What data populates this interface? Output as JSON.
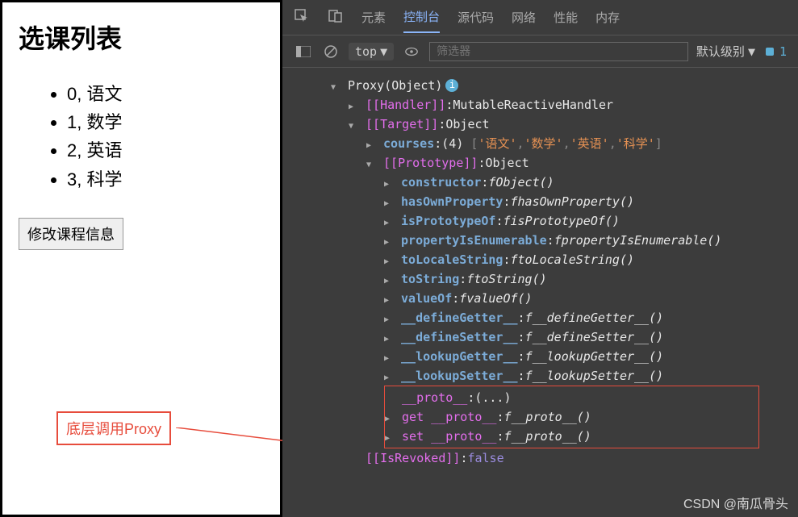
{
  "page": {
    "title": "选课列表",
    "courses": [
      "0, 语文",
      "1, 数学",
      "2, 英语",
      "3, 科学"
    ],
    "button": "修改课程信息"
  },
  "annotation": "底层调用Proxy",
  "devtools": {
    "tabs": {
      "elements": "元素",
      "console": "控制台",
      "sources": "源代码",
      "network": "网络",
      "performance": "性能",
      "memory": "内存"
    },
    "toolbar": {
      "scope": "top",
      "filter_placeholder": "筛选器",
      "level": "默认级别",
      "issue_count": "1"
    },
    "console": {
      "proxy_header": "Proxy(Object)",
      "handler_key": "[[Handler]]",
      "handler_val": "MutableReactiveHandler",
      "target_key": "[[Target]]",
      "target_val": "Object",
      "courses_key": "courses",
      "courses_len": "(4)",
      "courses_arr_open": "[",
      "courses_arr_close": "]",
      "courses_items": [
        "'语文'",
        "'数学'",
        "'英语'",
        "'科学'"
      ],
      "proto_key": "[[Prototype]]",
      "proto_val": "Object",
      "methods": [
        {
          "name": "constructor",
          "fn": "Object()"
        },
        {
          "name": "hasOwnProperty",
          "fn": "hasOwnProperty()"
        },
        {
          "name": "isPrototypeOf",
          "fn": "isPrototypeOf()"
        },
        {
          "name": "propertyIsEnumerable",
          "fn": "propertyIsEnumerable()"
        },
        {
          "name": "toLocaleString",
          "fn": "toLocaleString()"
        },
        {
          "name": "toString",
          "fn": "toString()"
        },
        {
          "name": "valueOf",
          "fn": "valueOf()"
        },
        {
          "name": "__defineGetter__",
          "fn": "__defineGetter__()"
        },
        {
          "name": "__defineSetter__",
          "fn": "__defineSetter__()"
        },
        {
          "name": "__lookupGetter__",
          "fn": "__lookupGetter__()"
        },
        {
          "name": "__lookupSetter__",
          "fn": "__lookupSetter__()"
        }
      ],
      "proto_accessor": "__proto__",
      "proto_accessor_val": "(...)",
      "get_proto_key": "get __proto__",
      "set_proto_key": "set __proto__",
      "proto_fn": "__proto__()",
      "revoked_key": "[[IsRevoked]]",
      "revoked_val": "false"
    }
  },
  "watermark": "CSDN @南瓜骨头"
}
